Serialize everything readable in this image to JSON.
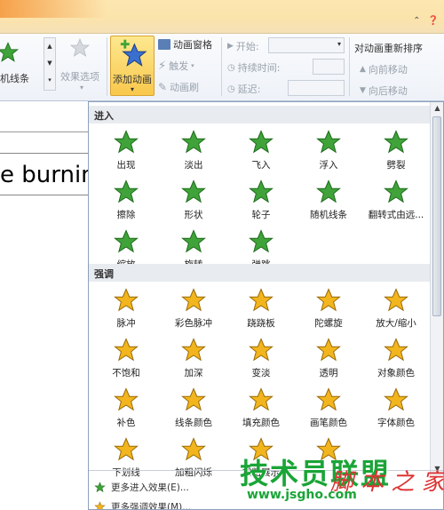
{
  "ribbon": {
    "gallery_item_label": "机线条",
    "effect_options_label": "效果选项",
    "add_animation_label": "添加动画",
    "anim_pane_label": "动画窗格",
    "trigger_label": "触发",
    "anim_painter_label": "动画刷",
    "start_label": "开始:",
    "duration_label": "持续时间:",
    "delay_label": "延迟:",
    "reorder_title": "对动画重新排序",
    "move_earlier_label": "向前移动",
    "move_later_label": "向后移动"
  },
  "document": {
    "visible_text": "e burnin"
  },
  "gallery": {
    "entrance_header": "进入",
    "entrance_items": [
      {
        "label": "出现",
        "icon": "star-appear-icon"
      },
      {
        "label": "淡出",
        "icon": "star-fade-icon"
      },
      {
        "label": "飞入",
        "icon": "star-fly-in-icon"
      },
      {
        "label": "浮入",
        "icon": "star-float-in-icon"
      },
      {
        "label": "劈裂",
        "icon": "star-split-icon"
      },
      {
        "label": "擦除",
        "icon": "star-wipe-icon"
      },
      {
        "label": "形状",
        "icon": "star-shape-icon"
      },
      {
        "label": "轮子",
        "icon": "star-wheel-icon"
      },
      {
        "label": "随机线条",
        "icon": "star-random-bars-icon"
      },
      {
        "label": "翻转式由远...",
        "icon": "star-grow-turn-icon"
      },
      {
        "label": "缩放",
        "icon": "star-zoom-icon"
      },
      {
        "label": "旋转",
        "icon": "star-swivel-icon"
      },
      {
        "label": "弹跳",
        "icon": "star-bounce-icon"
      }
    ],
    "emphasis_header": "强调",
    "emphasis_items": [
      {
        "label": "脉冲",
        "icon": "star-pulse-icon"
      },
      {
        "label": "彩色脉冲",
        "icon": "star-color-pulse-icon"
      },
      {
        "label": "跷跷板",
        "icon": "star-teeter-icon"
      },
      {
        "label": "陀螺旋",
        "icon": "star-spin-icon"
      },
      {
        "label": "放大/缩小",
        "icon": "star-grow-shrink-icon"
      },
      {
        "label": "不饱和",
        "icon": "star-desaturate-icon"
      },
      {
        "label": "加深",
        "icon": "star-darken-icon"
      },
      {
        "label": "变淡",
        "icon": "star-lighten-icon"
      },
      {
        "label": "透明",
        "icon": "star-transparency-icon"
      },
      {
        "label": "对象颜色",
        "icon": "star-object-color-icon"
      },
      {
        "label": "补色",
        "icon": "star-complementary-color-icon"
      },
      {
        "label": "线条颜色",
        "icon": "star-line-color-icon"
      },
      {
        "label": "填充颜色",
        "icon": "star-fill-color-icon"
      },
      {
        "label": "画笔颜色",
        "icon": "star-brush-color-icon"
      },
      {
        "label": "字体颜色",
        "icon": "star-font-color-icon"
      },
      {
        "label": "下划线",
        "icon": "star-underline-icon"
      },
      {
        "label": "加粗闪烁",
        "icon": "star-bold-flash-icon"
      },
      {
        "label": "加粗展示",
        "icon": "star-bold-reveal-icon"
      },
      {
        "label": "",
        "icon": "star-wave-icon"
      }
    ],
    "more_entrance": "更多进入效果(E)...",
    "more_emphasis": "更多强调效果(M)..."
  },
  "watermark": {
    "brand": "技术员联盟",
    "url": "www.jsgho.com",
    "script": "脚 本 之 家"
  },
  "colors": {
    "entrance_green": "#3fa33a",
    "emphasis_gold": "#f2b51e",
    "highlight": "#f9c84c"
  }
}
